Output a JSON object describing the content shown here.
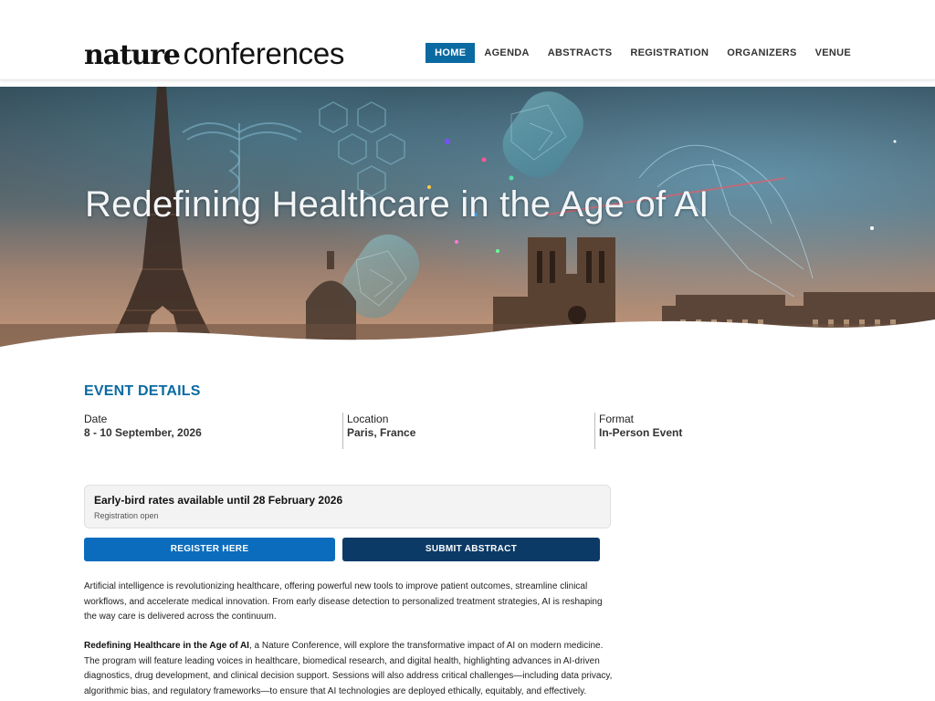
{
  "header": {
    "logo_bold": "nature",
    "logo_light": "conferences",
    "nav": [
      {
        "label": "HOME",
        "active": true
      },
      {
        "label": "AGENDA"
      },
      {
        "label": "ABSTRACTS"
      },
      {
        "label": "REGISTRATION"
      },
      {
        "label": "ORGANIZERS"
      },
      {
        "label": "VENUE"
      }
    ]
  },
  "hero": {
    "title": "Redefining Healthcare in the Age of AI"
  },
  "event": {
    "section_title": "EVENT DETAILS",
    "date_label": "Date",
    "date_value": "8 - 10 September, 2026",
    "location_label": "Location",
    "location_value": "Paris, France",
    "format_label": "Format",
    "format_value": "In-Person Event"
  },
  "early_bird": {
    "headline": "Early-bird rates available until 28 February 2026",
    "subtext": "Registration open"
  },
  "buttons": {
    "register": "REGISTER HERE",
    "abstract": "SUBMIT ABSTRACT"
  },
  "body": {
    "p1": "Artificial intelligence is revolutionizing healthcare, offering powerful new tools to improve patient outcomes, streamline clinical workflows, and accelerate medical innovation. From early disease detection to personalized treatment strategies, AI is reshaping the way care is delivered across the continuum.",
    "p2_bold": "Redefining Healthcare in the Age of AI",
    "p2_rest": ", a Nature Conference, will explore the transformative impact of AI on modern medicine. The program will feature leading voices in healthcare, biomedical research, and digital health, highlighting advances in AI-driven diagnostics, drug development, and clinical decision support. Sessions will also address critical challenges—including data privacy, algorithmic bias, and regulatory frameworks—to ensure that AI technologies are deployed ethically, equitably, and effectively."
  },
  "colors": {
    "accent": "#0b6aa2",
    "register_btn": "#0b6cbd",
    "abstract_btn": "#0c3a66"
  }
}
